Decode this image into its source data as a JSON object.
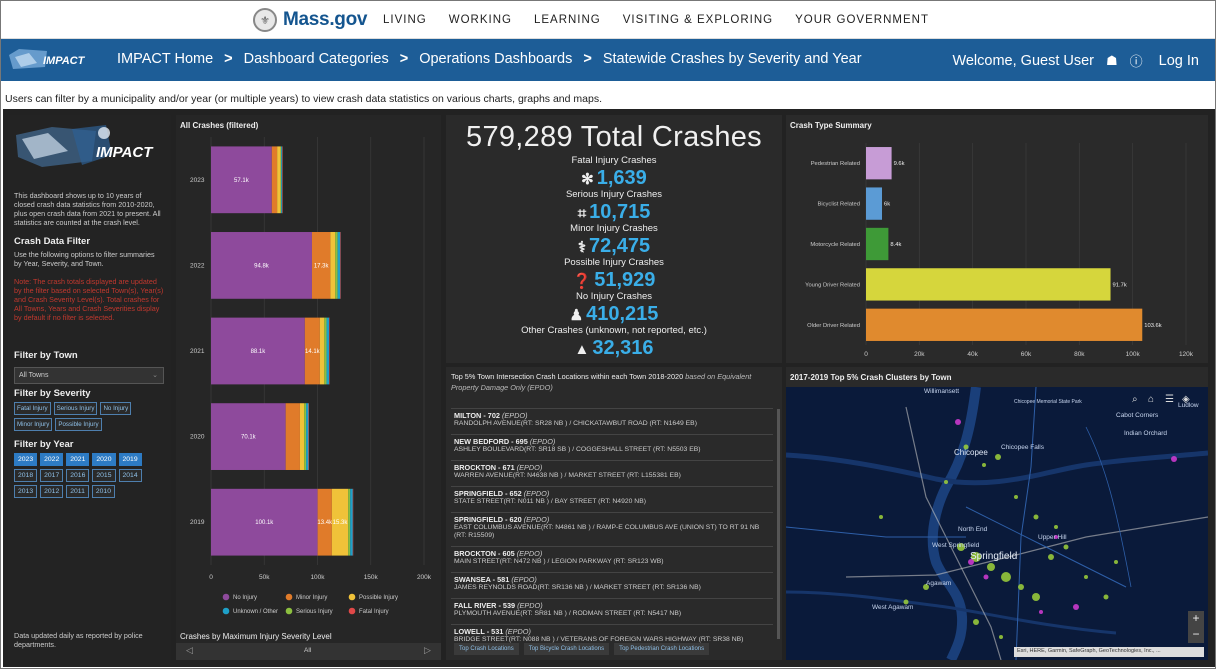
{
  "massgov": {
    "logo_text": "Mass.gov",
    "nav": [
      "LIVING",
      "WORKING",
      "LEARNING",
      "VISITING & EXPLORING",
      "YOUR GOVERNMENT"
    ]
  },
  "impact_header": {
    "logo_text": "IMPACT",
    "breadcrumbs": [
      "IMPACT Home",
      "Dashboard Categories",
      "Operations Dashboards",
      "Statewide Crashes by Severity and Year"
    ],
    "separator": ">",
    "welcome": "Welcome, Guest User",
    "login": "Log In"
  },
  "description": "Users can filter by a municipality and/or year (or multiple years) to view crash data statistics on various charts, graphs and maps.",
  "left_panel": {
    "logo_text": "IMPACT",
    "intro": "This dashboard shows up to 10 years of closed crash data statistics from 2010-2020, plus open crash data from 2021 to present. All statistics are counted at the crash level.",
    "filter_heading": "Crash Data Filter",
    "filter_help": "Use the following options to filter summaries by Year, Severity, and Town.",
    "note": "Note: The crash totals displayed are updated by the filter based on selected Town(s), Year(s) and Crash Severity Level(s). Total crashes for All Towns, Years and Crash Severities display by default if no filter is selected.",
    "town_heading": "Filter by Town",
    "town_value": "All Towns",
    "severity_heading": "Filter by Severity",
    "severities": [
      "Fatal Injury",
      "Serious Injury",
      "No Injury",
      "Minor Injury",
      "Possible Injury"
    ],
    "year_heading": "Filter by Year",
    "years": [
      "2023",
      "2022",
      "2021",
      "2020",
      "2019",
      "2018",
      "2017",
      "2016",
      "2015",
      "2014",
      "2013",
      "2012",
      "2011",
      "2010"
    ],
    "years_selected": [
      "2023",
      "2022",
      "2021",
      "2020",
      "2019"
    ],
    "footer": "Data updated daily as reported by police departments."
  },
  "bar_chart": {
    "title": "All Crashes (filtered)",
    "footer_title": "Crashes by Maximum Injury Severity Level",
    "footer_value": "All"
  },
  "chart_data": [
    {
      "type": "bar",
      "title": "All Crashes (filtered)",
      "orientation": "horizontal-stacked",
      "categories": [
        "2023",
        "2022",
        "2021",
        "2020",
        "2019"
      ],
      "xlim": [
        0,
        200000
      ],
      "x_ticks": [
        "0",
        "50k",
        "100k",
        "150k",
        "200k"
      ],
      "series": [
        {
          "name": "No Injury",
          "color": "#8e4a9c",
          "values": [
            57100,
            94800,
            88100,
            70100,
            100100
          ]
        },
        {
          "name": "Minor Injury",
          "color": "#e07b2a",
          "values": [
            5000,
            17300,
            14100,
            13400,
            13400
          ]
        },
        {
          "name": "Possible Injury",
          "color": "#f0c239",
          "values": [
            3100,
            4600,
            4200,
            4000,
            15300
          ]
        },
        {
          "name": "Serious Injury",
          "color": "#8cbf3f",
          "values": [
            700,
            2200,
            2100,
            1800,
            1900
          ]
        },
        {
          "name": "Unknown / Other",
          "color": "#1ea0c8",
          "values": [
            1000,
            2500,
            2400,
            2200,
            2400
          ]
        },
        {
          "name": "Fatal Injury",
          "color": "#e04848",
          "values": [
            300,
            400,
            400,
            350,
            400
          ]
        }
      ],
      "data_labels": [
        [
          "57.1k"
        ],
        [
          "94.8k",
          "17.3k"
        ],
        [
          "88.1k",
          "14.1k"
        ],
        [
          "70.1k"
        ],
        [
          "100.1k",
          "13.4k",
          "15.3k"
        ]
      ],
      "legend": [
        "No Injury",
        "Minor Injury",
        "Possible Injury",
        "Unknown / Other",
        "Serious Injury",
        "Fatal Injury"
      ]
    },
    {
      "type": "bar",
      "title": "Crash Type Summary",
      "orientation": "horizontal",
      "categories": [
        "Pedestrian Related",
        "Bicyclist Related",
        "Motorcycle Related",
        "Young Driver Related",
        "Older Driver Related"
      ],
      "values": [
        9600,
        6000,
        8400,
        91700,
        103600
      ],
      "labels": [
        "9.6k",
        "6k",
        "8.4k",
        "91.7k",
        "103.6k"
      ],
      "colors": [
        "#c79cd6",
        "#5b9bd5",
        "#3e9a37",
        "#d6d63c",
        "#e08a2e"
      ],
      "xlim": [
        0,
        120000
      ],
      "x_ticks": [
        "0",
        "20k",
        "40k",
        "60k",
        "80k",
        "100k",
        "120k"
      ]
    }
  ],
  "totals": {
    "big": "579,289 Total Crashes",
    "items": [
      {
        "label": "Fatal Injury Crashes",
        "icon": "✻",
        "value": "1,639"
      },
      {
        "label": "Serious Injury Crashes",
        "icon": "⌗",
        "value": "10,715"
      },
      {
        "label": "Minor Injury Crashes",
        "icon": "⚕",
        "value": "72,475"
      },
      {
        "label": "Possible Injury Crashes",
        "icon": "❓",
        "value": "51,929"
      },
      {
        "label": "No Injury Crashes",
        "icon": "♟",
        "value": "410,215"
      },
      {
        "label": "Other Crashes (unknown, not reported, etc.)",
        "icon": "▲",
        "value": "32,316"
      }
    ]
  },
  "crash_type": {
    "title": "Crash Type Summary"
  },
  "top_list": {
    "title": "Top 5% Town Intersection Crash Locations within each Town 2018-2020",
    "title_note": "based on Equivalent Property Damage Only (EPDO)",
    "rows": [
      {
        "title": "MILTON - 702",
        "epdo": "(EPDO)",
        "sub": "RANDOLPH AVENUE(RT: SR28 NB ) / CHICKATAWBUT ROAD (RT: N1649 EB)"
      },
      {
        "title": "NEW BEDFORD - 695",
        "epdo": "(EPDO)",
        "sub": "ASHLEY BOULEVARD(RT: SR18 SB ) / COGGESHALL STREET (RT: N5503 EB)"
      },
      {
        "title": "BROCKTON - 671",
        "epdo": "(EPDO)",
        "sub": "WARREN AVENUE(RT: N4638 NB ) / MARKET STREET (RT: L155381 EB)"
      },
      {
        "title": "SPRINGFIELD - 652",
        "epdo": "(EPDO)",
        "sub": "STATE STREET(RT: N011 NB ) / BAY STREET (RT: N4920 NB)"
      },
      {
        "title": "SPRINGFIELD - 620",
        "epdo": "(EPDO)",
        "sub": "EAST COLUMBUS AVENUE(RT: N4861 NB ) / RAMP-E COLUMBUS AVE (UNION ST) TO RT 91 NB (RT: R15509)"
      },
      {
        "title": "BROCKTON - 605",
        "epdo": "(EPDO)",
        "sub": "MAIN STREET(RT: N472 NB ) / LEGION PARKWAY (RT: SR123 WB)"
      },
      {
        "title": "SWANSEA - 581",
        "epdo": "(EPDO)",
        "sub": "JAMES REYNOLDS ROAD(RT: SR136 NB ) / MARKET STREET (RT: SR136 NB)"
      },
      {
        "title": "FALL RIVER - 539",
        "epdo": "(EPDO)",
        "sub": "PLYMOUTH AVENUE(RT: SR81 NB ) / RODMAN STREET (RT: N5417 NB)"
      },
      {
        "title": "LOWELL - 531",
        "epdo": "(EPDO)",
        "sub": "BRIDGE STREET(RT: N088 NB ) / VETERANS OF FOREIGN WARS HIGHWAY (RT: SR38 NB)"
      }
    ],
    "tabs": [
      "Top Crash Locations",
      "Top Bicycle Crash Locations",
      "Top Pedestrian Crash Locations"
    ]
  },
  "map": {
    "title": "2017-2019 Top 5% Crash Clusters by Town",
    "places": [
      "Willimansett",
      "Chicopee Memorial State Park",
      "Cabot Corners",
      "Ludlow",
      "Indian Orchard",
      "Chicopee",
      "Chicopee Falls",
      "North End",
      "West Springfield",
      "Springfield",
      "Upper Hill",
      "Agawam",
      "West Agawam"
    ],
    "attribution": "Esri, HERE, Garmin, SafeGraph, GeoTechnologies, Inc., ...",
    "tools": [
      "search-icon",
      "home-icon",
      "list-icon",
      "layers-icon"
    ]
  }
}
